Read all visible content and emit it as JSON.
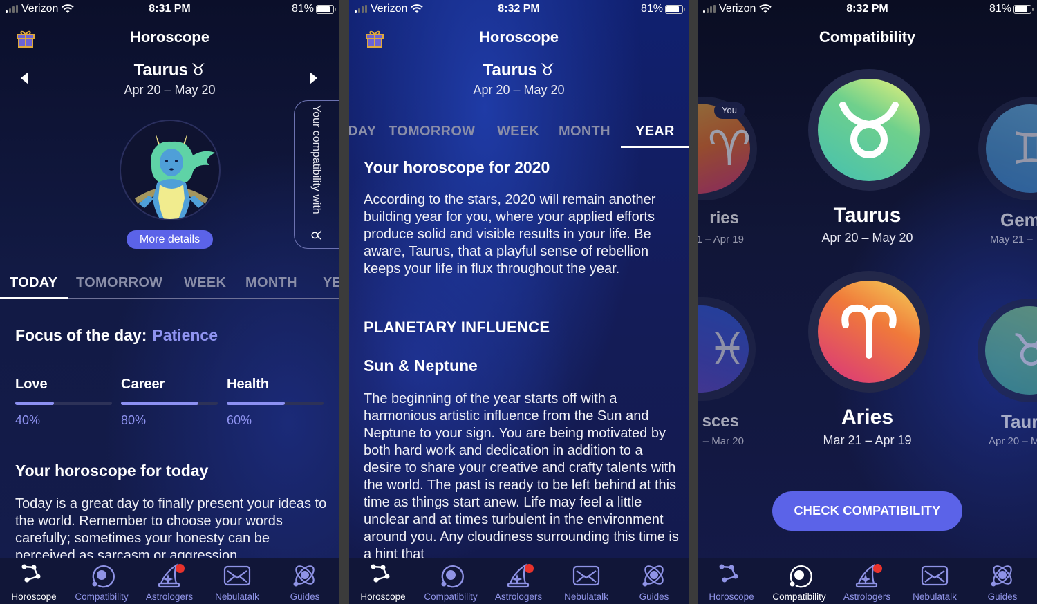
{
  "status_bars": [
    {
      "carrier": "Verizon",
      "time": "8:31 PM",
      "battery": "81%"
    },
    {
      "carrier": "Verizon",
      "time": "8:32 PM",
      "battery": "81%"
    },
    {
      "carrier": "Verizon",
      "time": "8:32 PM",
      "battery": "81%"
    }
  ],
  "screen1": {
    "title": "Horoscope",
    "sign": {
      "name": "Taurus",
      "glyph": "♉︎",
      "dates": "Apr 20 – May 20"
    },
    "more_details": "More details",
    "compat_tab": {
      "text": "Your compatibility with",
      "glyph": "♉︎"
    },
    "tabs": [
      "TODAY",
      "TOMORROW",
      "WEEK",
      "MONTH",
      "YE"
    ],
    "active_tab": "TODAY",
    "focus_label": "Focus of the day:",
    "focus_value": "Patience",
    "meters": [
      {
        "label": "Love",
        "percent": 40,
        "display": "40%"
      },
      {
        "label": "Career",
        "percent": 80,
        "display": "80%"
      },
      {
        "label": "Health",
        "percent": 60,
        "display": "60%"
      }
    ],
    "heading": "Your horoscope for today",
    "body": "Today is a great day to finally present your ideas to the world. Remember to choose your words carefully; sometimes your honesty can be perceived as sarcasm or aggression"
  },
  "screen2": {
    "title": "Horoscope",
    "sign": {
      "name": "Taurus",
      "glyph": "♉︎",
      "dates": "Apr 20 – May 20"
    },
    "tabs": [
      "DAY",
      "TOMORROW",
      "WEEK",
      "MONTH",
      "YEAR"
    ],
    "active_tab": "YEAR",
    "heading": "Your horoscope for 2020",
    "intro": "According to the stars, 2020 will remain another building year for you, where your applied efforts produce solid and visible results in your life. Be aware, Taurus, that a playful sense of rebellion keeps your life in flux throughout the year.",
    "section": "PLANETARY INFLUENCE",
    "subsection": "Sun & Neptune",
    "body": "The beginning of the year starts off with a harmonious artistic influence from the Sun and Neptune to your sign. You are being motivated by both hard work and dedication in addition to a desire to share your creative and crafty talents with the world. The past is ready to be left behind at this time as things start anew. Life may feel a little unclear and at times turbulent in the environment around you. Any cloudiness surrounding this time is a hint that"
  },
  "screen3": {
    "title": "Compatibility",
    "you_badge": "You",
    "row1": [
      {
        "name": "ries",
        "dates": "1 – Apr 19",
        "glyph": "♈︎"
      },
      {
        "name": "Taurus",
        "dates": "Apr 20 – May 20",
        "glyph": "♉︎"
      },
      {
        "name": "Gem",
        "dates": "May 21 –",
        "glyph": "♊︎"
      }
    ],
    "row2": [
      {
        "name": "sces",
        "dates": "– Mar 20",
        "glyph": "♓︎"
      },
      {
        "name": "Aries",
        "dates": "Mar 21 – Apr 19",
        "glyph": "♈︎"
      },
      {
        "name": "Taur",
        "dates": "Apr 20 – M",
        "glyph": "♉︎"
      }
    ],
    "check_button": "CHECK COMPATIBILITY"
  },
  "nav": {
    "items": [
      "Horoscope",
      "Compatibility",
      "Astrologers",
      "Nebulatalk",
      "Guides"
    ],
    "active_per_screen": [
      "Horoscope",
      "Horoscope",
      "Compatibility"
    ],
    "notification_on": "Astrologers"
  },
  "colors": {
    "accent": "#5b63e8",
    "accent_text": "#8f93f0",
    "notification": "#e8322c",
    "nav_bg": "#111638"
  }
}
